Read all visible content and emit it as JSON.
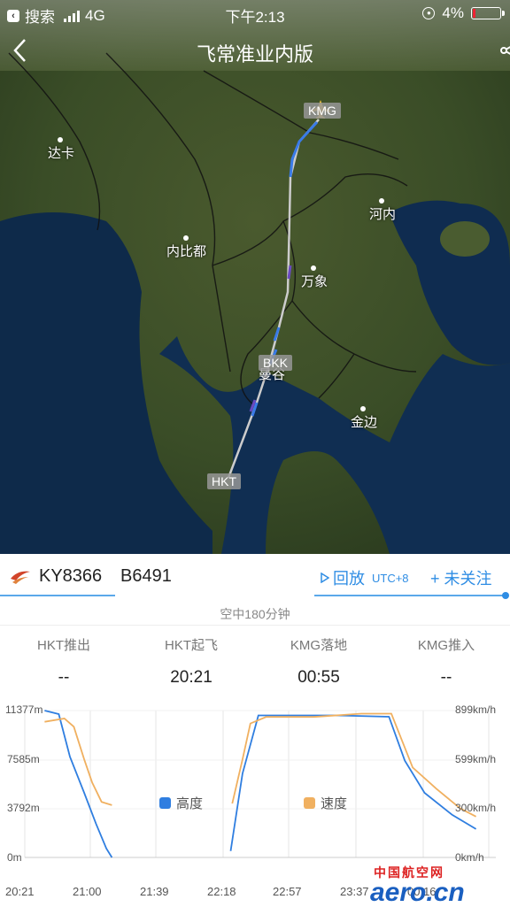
{
  "status_bar": {
    "back_app": "搜索",
    "network": "4G",
    "time": "下午2:13",
    "battery": "4%"
  },
  "nav": {
    "title": "飞常准业内版",
    "back_icon": "chevron-left-icon",
    "share_icon": "share-icon"
  },
  "map": {
    "cities": [
      {
        "name": "达卡"
      },
      {
        "name": "内比都"
      },
      {
        "name": "河内"
      },
      {
        "name": "万象"
      },
      {
        "name": "曼谷"
      },
      {
        "name": "金边"
      }
    ],
    "airports": [
      "KMG",
      "BKK",
      "HKT"
    ]
  },
  "flight": {
    "number": "KY8366",
    "registration": "B6491",
    "replay_label": "回放",
    "timezone": "UTC+8",
    "follow_label": "+ 未关注",
    "air_time": "空中180分钟"
  },
  "timeline": [
    {
      "label": "HKT推出",
      "value": "--"
    },
    {
      "label": "HKT起飞",
      "value": "20:21"
    },
    {
      "label": "KMG落地",
      "value": "00:55"
    },
    {
      "label": "KMG推入",
      "value": "--"
    }
  ],
  "colors": {
    "accent": "#2f8de4",
    "altitude": "#2f7ee0",
    "speed": "#f0b060"
  },
  "chart_data": {
    "type": "line",
    "x_ticks": [
      "20:21",
      "21:00",
      "21:39",
      "22:18",
      "22:57",
      "23:37",
      "00:16"
    ],
    "y_left_ticks": [
      "11377m",
      "7585m",
      "3792m",
      "0m"
    ],
    "y_right_ticks": [
      "899km/h",
      "599km/h",
      "300km/h",
      "0km/h"
    ],
    "series": [
      {
        "name": "高度",
        "unit": "m",
        "segments": [
          [
            [
              20.6,
              11377
            ],
            [
              20.78,
              11100
            ],
            [
              20.92,
              7800
            ],
            [
              21.1,
              5000
            ],
            [
              21.25,
              2600
            ],
            [
              21.38,
              700
            ],
            [
              21.45,
              0
            ]
          ],
          [
            [
              22.95,
              500
            ],
            [
              23.1,
              6500
            ],
            [
              23.3,
              11000
            ],
            [
              23.8,
              11000
            ],
            [
              24.3,
              11000
            ],
            [
              24.95,
              10900
            ],
            [
              25.15,
              7500
            ],
            [
              25.4,
              5000
            ],
            [
              25.75,
              3300
            ],
            [
              26.05,
              2200
            ]
          ]
        ]
      },
      {
        "name": "速度",
        "unit": "km/h",
        "segments": [
          [
            [
              20.6,
              830
            ],
            [
              20.85,
              850
            ],
            [
              20.97,
              800
            ],
            [
              21.1,
              600
            ],
            [
              21.2,
              460
            ],
            [
              21.32,
              340
            ],
            [
              21.45,
              320
            ]
          ],
          [
            [
              22.97,
              330
            ],
            [
              23.1,
              600
            ],
            [
              23.2,
              820
            ],
            [
              23.4,
              860
            ],
            [
              24.0,
              860
            ],
            [
              24.6,
              880
            ],
            [
              24.98,
              880
            ],
            [
              25.25,
              550
            ],
            [
              25.55,
              420
            ],
            [
              25.85,
              300
            ],
            [
              26.05,
              250
            ]
          ]
        ]
      }
    ],
    "altitude_max": 11377,
    "speed_max": 899
  },
  "watermark": "中国航空网 aero.cn"
}
